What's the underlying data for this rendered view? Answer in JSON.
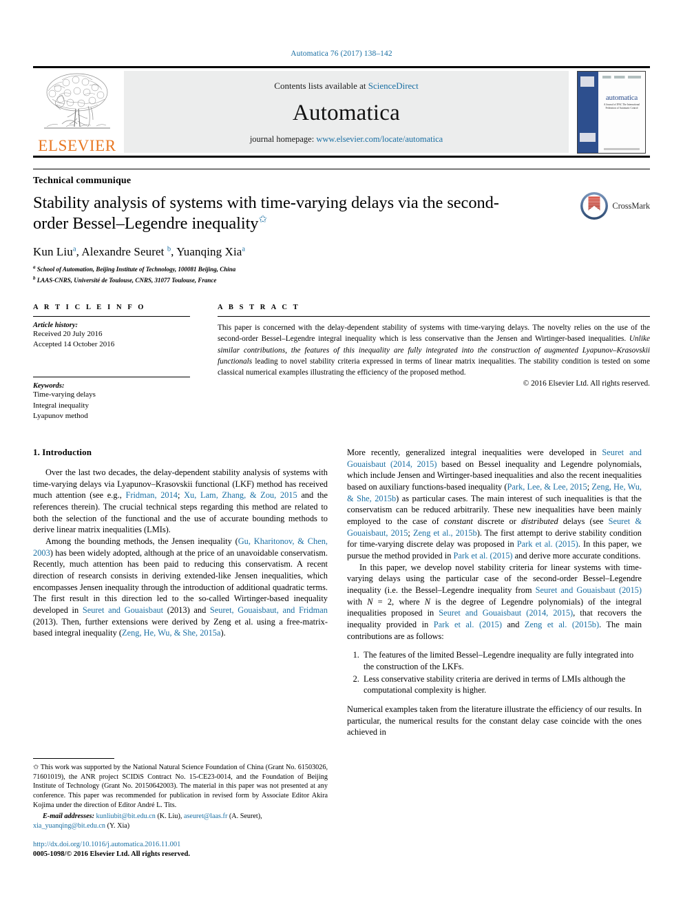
{
  "running_head": "Automatica 76 (2017) 138–142",
  "masthead": {
    "contents_prefix": "Contents lists available at ",
    "contents_link": "ScienceDirect",
    "journal_name": "Automatica",
    "homepage_prefix": "journal homepage: ",
    "homepage_url": "www.elsevier.com/locate/automatica",
    "publisher_wordmark": "ELSEVIER",
    "cover_title": "automatica",
    "cover_subtitle": "A Journal of IFAC The International Federation of Automatic Control"
  },
  "article": {
    "section_type": "Technical communique",
    "title": "Stability analysis of systems with time-varying delays via the second-order Bessel–Legendre inequality",
    "title_footnote_marker": "✩",
    "authors": "Kun Liu a, Alexandre Seuret b, Yuanqing Xia a",
    "author_list": [
      {
        "name": "Kun Liu",
        "sup": "a"
      },
      {
        "name": "Alexandre Seuret",
        "sup": "b"
      },
      {
        "name": "Yuanqing Xia",
        "sup": "a"
      }
    ],
    "affiliations": [
      {
        "sup": "a",
        "text": "School of Automation, Beijing Institute of Technology, 100081 Beijing, China"
      },
      {
        "sup": "b",
        "text": "LAAS-CNRS, Université de Toulouse, CNRS, 31077 Toulouse, France"
      }
    ],
    "crossmark_label": "CrossMark"
  },
  "info": {
    "heading": "A R T I C L E   I N F O",
    "history_label": "Article history:",
    "received": "Received 20 July 2016",
    "accepted": "Accepted 14 October 2016",
    "keywords_label": "Keywords:",
    "keywords": [
      "Time-varying delays",
      "Integral inequality",
      "Lyapunov method"
    ]
  },
  "abstract": {
    "heading": "A B S T R A C T",
    "part1": "This paper is concerned with the delay-dependent stability of systems with time-varying delays. The novelty relies on the use of the second-order Bessel–Legendre integral inequality which is less conservative than the Jensen and Wirtinger-based inequalities. ",
    "italic": "Unlike similar contributions, the features of this inequality are fully integrated into the construction of augmented Lyapunov–Krasovskii functionals",
    "part2": " leading to novel stability criteria expressed in terms of linear matrix inequalities. The stability condition is tested on some classical numerical examples illustrating the efficiency of the proposed method.",
    "copyright": "© 2016 Elsevier Ltd. All rights reserved."
  },
  "introduction": {
    "heading": "1. Introduction",
    "para1": "Over the last two decades, the delay-dependent stability analysis of systems with time-varying delays via Lyapunov–Krasovskii functional (LKF) method has received much attention (see e.g., Fridman, 2014; Xu, Lam, Zhang, & Zou, 2015 and the references therein). The crucial technical steps regarding this method are related to both the selection of the functional and the use of accurate bounding methods to derive linear matrix inequalities (LMIs).",
    "para2": "Among the bounding methods, the Jensen inequality (Gu, Kharitonov, & Chen, 2003) has been widely adopted, although at the price of an unavoidable conservatism. Recently, much attention has been paid to reducing this conservatism. A recent direction of research consists in deriving extended-like Jensen inequalities, which encompasses Jensen inequality through the introduction of additional quadratic terms. The first result in this direction led to the so-called Wirtinger-based inequality developed in Seuret and Gouaisbaut (2013) and Seuret, Gouaisbaut, and Fridman (2013). Then, further extensions were derived by Zeng et al. using a free-matrix-based integral inequality (Zeng, He, Wu, & She, 2015a).",
    "para3": "More recently, generalized integral inequalities were developed in Seuret and Gouaisbaut (2014, 2015) based on Bessel inequality and Legendre polynomials, which include Jensen and Wirtinger-based inequalities and also the recent inequalities based on auxiliary functions-based inequality (Park, Lee, & Lee, 2015; Zeng, He, Wu, & She, 2015b) as particular cases. The main interest of such inequalities is that the conservatism can be reduced arbitrarily. These new inequalities have been mainly employed to the case of constant discrete or distributed delays (see Seuret & Gouaisbaut, 2015; Zeng et al., 2015b). The first attempt to derive stability condition for time-varying discrete delay was proposed in Park et al. (2015). In this paper, we pursue the method provided in Park et al. (2015) and derive more accurate conditions.",
    "para4": "In this paper, we develop novel stability criteria for linear systems with time-varying delays using the particular case of the second-order Bessel–Legendre inequality (i.e. the Bessel–Legendre inequality from Seuret and Gouaisbaut (2015) with N = 2, where N is the degree of Legendre polynomials) of the integral inequalities proposed in Seuret and Gouaisbaut (2014, 2015), that recovers the inequality provided in Park et al. (2015) and Zeng et al. (2015b). The main contributions are as follows:",
    "contributions": [
      "The features of the limited Bessel–Legendre inequality are fully integrated into the construction of the LKFs.",
      "Less conservative stability criteria are derived in terms of LMIs although the computational complexity is higher."
    ],
    "para5": "Numerical examples taken from the literature illustrate the efficiency of our results. In particular, the numerical results for the constant delay case coincide with the ones achieved in"
  },
  "footnote": {
    "star": "✩",
    "text": "This work was supported by the National Natural Science Foundation of China (Grant No. 61503026, 71601019), the ANR project SCIDiS Contract No. 15-CE23-0014, and the Foundation of Beijing Institute of Technology (Grant No. 20150642003). The material in this paper was not presented at any conference. This paper was recommended for publication in revised form by Associate Editor Akira Kojima under the direction of Editor André L. Tits.",
    "email_label": "E-mail addresses:",
    "emails": [
      {
        "address": "kunliubit@bit.edu.cn",
        "owner": "(K. Liu)"
      },
      {
        "address": "aseuret@laas.fr",
        "owner": "(A. Seuret)"
      },
      {
        "address": "xia_yuanqing@bit.edu.cn",
        "owner": "(Y. Xia)"
      }
    ],
    "doi": "http://dx.doi.org/10.1016/j.automatica.2016.11.001",
    "issn": "0005-1098/© 2016 Elsevier Ltd. All rights reserved."
  },
  "colors": {
    "link": "#1a6fa3",
    "elsevier_orange": "#E87722",
    "cover_blue": "#2d4f8e",
    "masthead_gray": "#eceded"
  }
}
